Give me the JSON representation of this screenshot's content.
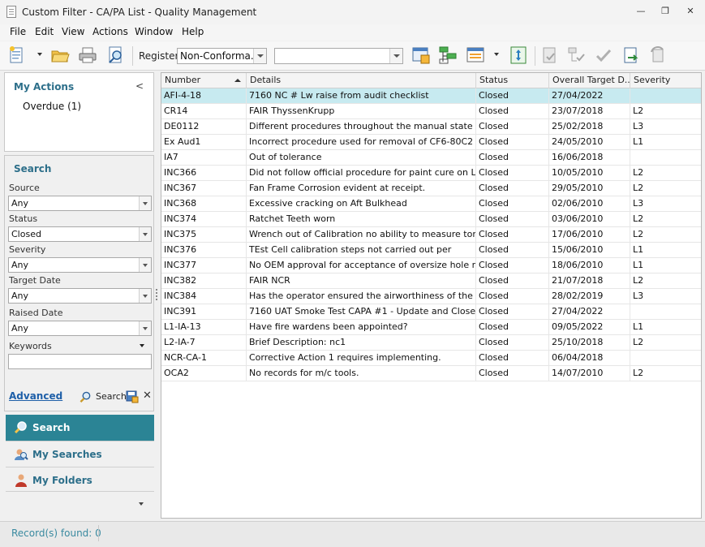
{
  "window": {
    "title": "Custom Filter - CA/PA List - Quality Management",
    "minimize_glyph": "—",
    "restore_glyph": "❐",
    "close_glyph": "✕"
  },
  "menu": [
    "File",
    "Edit",
    "View",
    "Actions",
    "Window",
    "Help"
  ],
  "toolbar": {
    "register_label": "Register",
    "register_value": "Non-Conforma...",
    "second_combo_value": "",
    "icons": [
      "new-doc-icon",
      "open-folder-icon",
      "print-icon",
      "find-icon",
      "save-layout-icon",
      "tree-view-icon",
      "columns-icon",
      "expand-icon",
      "approve-doc-icon",
      "approve-tree-icon",
      "check-icon",
      "export-icon",
      "refresh-icon"
    ]
  },
  "my_actions": {
    "title": "My Actions",
    "collapse_glyph": "<",
    "items": [
      "Overdue (1)"
    ]
  },
  "search_panel": {
    "title": "Search",
    "fields": [
      {
        "label": "Source",
        "value": "Any"
      },
      {
        "label": "Status",
        "value": "Closed"
      },
      {
        "label": "Severity",
        "value": "Any"
      },
      {
        "label": "Target Date",
        "value": "Any"
      },
      {
        "label": "Raised Date",
        "value": "Any"
      }
    ],
    "keywords_label": "Keywords",
    "keywords_value": "",
    "advanced_label": "Advanced",
    "search_label": "Search",
    "clear_glyph": "✕"
  },
  "nav": [
    {
      "label": "Search",
      "active": true
    },
    {
      "label": "My Searches",
      "active": false
    },
    {
      "label": "My Folders",
      "active": false
    }
  ],
  "grid": {
    "columns": [
      "Number",
      "Details",
      "Status",
      "Overall Target D...",
      "Severity"
    ],
    "rows": [
      {
        "number": "AFI-4-18",
        "details": "7160 NC # Lw raise from audit checklist",
        "status": "Closed",
        "target": "27/04/2022",
        "severity": "",
        "selected": true
      },
      {
        "number": "CR14",
        "details": "FAIR ThyssenKrupp",
        "status": "Closed",
        "target": "23/07/2018",
        "severity": "L2"
      },
      {
        "number": "DE0112",
        "details": "Different procedures throughout the manual state",
        "status": "Closed",
        "target": "25/02/2018",
        "severity": "L3"
      },
      {
        "number": "Ex Aud1",
        "details": "Incorrect procedure used for removal of CF6-80C2",
        "status": "Closed",
        "target": "24/05/2010",
        "severity": "L1"
      },
      {
        "number": "IA7",
        "details": "Out of tolerance",
        "status": "Closed",
        "target": "16/06/2018",
        "severity": ""
      },
      {
        "number": "INC366",
        "details": "Did not follow official procedure for paint cure on L/H",
        "status": "Closed",
        "target": "10/05/2010",
        "severity": "L2"
      },
      {
        "number": "INC367",
        "details": "Fan Frame Corrosion evident at receipt.",
        "status": "Closed",
        "target": "29/05/2010",
        "severity": "L2"
      },
      {
        "number": "INC368",
        "details": "Excessive cracking on Aft Bulkhead",
        "status": "Closed",
        "target": "02/06/2010",
        "severity": "L3"
      },
      {
        "number": "INC374",
        "details": "Ratchet Teeth worn",
        "status": "Closed",
        "target": "03/06/2010",
        "severity": "L2"
      },
      {
        "number": "INC375",
        "details": "Wrench out of Calibration no ability to measure torque.",
        "status": "Closed",
        "target": "17/06/2010",
        "severity": "L2"
      },
      {
        "number": "INC376",
        "details": "TEst Cell calibration steps not carried out per",
        "status": "Closed",
        "target": "15/06/2010",
        "severity": "L1"
      },
      {
        "number": "INC377",
        "details": "No OEM approval for acceptance of oversize hole rework",
        "status": "Closed",
        "target": "18/06/2010",
        "severity": "L1"
      },
      {
        "number": "INC382",
        "details": "FAIR NCR",
        "status": "Closed",
        "target": "21/07/2018",
        "severity": "L2"
      },
      {
        "number": "INC384",
        "details": "Has the operator ensured the airworthiness of the",
        "status": "Closed",
        "target": "28/02/2019",
        "severity": "L3"
      },
      {
        "number": "INC391",
        "details": "7160 UAT Smoke Test CAPA #1 - Update and Close",
        "status": "Closed",
        "target": "27/04/2022",
        "severity": ""
      },
      {
        "number": "L1-IA-13",
        "details": "Have fire wardens been appointed?",
        "status": "Closed",
        "target": "09/05/2022",
        "severity": "L1"
      },
      {
        "number": "L2-IA-7",
        "details": "Brief Description: nc1",
        "status": "Closed",
        "target": "25/10/2018",
        "severity": "L2"
      },
      {
        "number": "NCR-CA-1",
        "details": "Corrective Action 1 requires implementing.",
        "status": "Closed",
        "target": "06/04/2018",
        "severity": ""
      },
      {
        "number": "OCA2",
        "details": "No records for m/c tools.",
        "status": "Closed",
        "target": "14/07/2010",
        "severity": "L2"
      }
    ]
  },
  "status_bar": {
    "records_found": "Record(s) found: 0"
  }
}
